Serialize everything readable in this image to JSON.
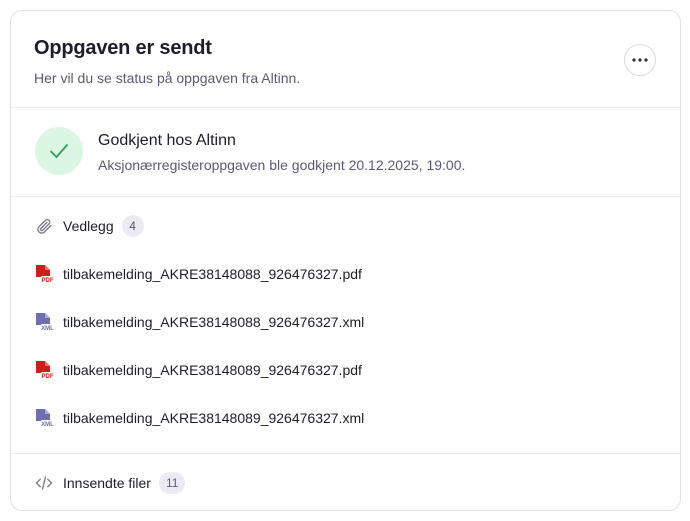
{
  "header": {
    "title": "Oppgaven er sendt",
    "subtitle": "Her vil du se status på oppgaven fra Altinn.",
    "more_icon": "more-horizontal-icon"
  },
  "status": {
    "icon": "check-icon",
    "title": "Godkjent hos Altinn",
    "description": "Aksjonærregisteroppgaven ble godkjent 20.12.2025, 19:00.",
    "color": "#dcf6e4"
  },
  "attachments": {
    "label": "Vedlegg",
    "count": "4",
    "files": [
      {
        "name": "tilbakemelding_AKRE38148088_926476327.pdf",
        "type": "pdf",
        "badge": "PDF"
      },
      {
        "name": "tilbakemelding_AKRE38148088_926476327.xml",
        "type": "xml",
        "badge": "XML"
      },
      {
        "name": "tilbakemelding_AKRE38148089_926476327.pdf",
        "type": "pdf",
        "badge": "PDF"
      },
      {
        "name": "tilbakemelding_AKRE38148089_926476327.xml",
        "type": "xml",
        "badge": "XML"
      }
    ]
  },
  "submitted": {
    "label": "Innsendte filer",
    "count": "11",
    "icon": "code-icon"
  },
  "colors": {
    "pdf": "#c8201b",
    "xml": "#6f6fb0",
    "success": "#2f9e57"
  }
}
